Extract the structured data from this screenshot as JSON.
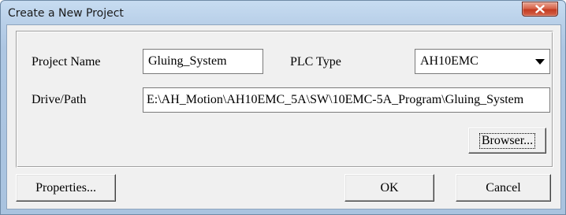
{
  "window": {
    "title": "Create a New Project",
    "close_icon": "close-x-icon"
  },
  "form": {
    "project_name_label": "Project Name",
    "project_name_value": "Gluing_System",
    "plc_type_label": "PLC Type",
    "plc_type_value": "AH10EMC",
    "drive_path_label": "Drive/Path",
    "drive_path_value": "E:\\AH_Motion\\AH10EMC_5A\\SW\\10EMC-5A_Program\\Gluing_System"
  },
  "buttons": {
    "browser": "Browser...",
    "properties": "Properties...",
    "ok": "OK",
    "cancel": "Cancel"
  }
}
